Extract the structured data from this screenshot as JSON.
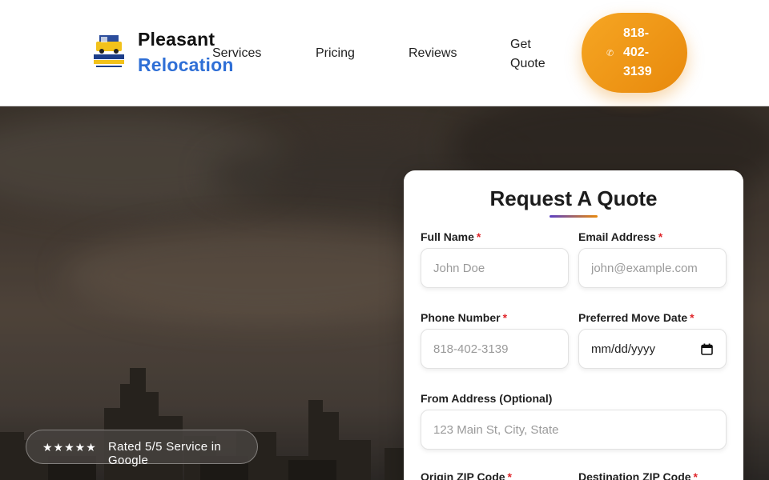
{
  "header": {
    "brand_line1": "Pleasant",
    "brand_line2": "Relocation",
    "logo_text": "PLEASANT RELOCATION",
    "nav": {
      "services": "Services",
      "pricing": "Pricing",
      "reviews": "Reviews",
      "get_quote": "Get Quote"
    },
    "phone": "818-402-3139",
    "phone_icon": "phone-icon",
    "accent_color": "#e8890c",
    "brand_color": "#2f6fd6"
  },
  "hero": {
    "rating_stars": "★★★★★",
    "rating_text": "Rated 5/5 Service in Google"
  },
  "quote_form": {
    "title": "Request A Quote",
    "required_mark": "*",
    "full_name": {
      "label": "Full Name",
      "placeholder": "John Doe"
    },
    "email": {
      "label": "Email Address",
      "placeholder": "john@example.com"
    },
    "phone": {
      "label": "Phone Number",
      "placeholder": "818-402-3139"
    },
    "move_date": {
      "label": "Preferred Move Date",
      "value": "mm/dd/yyyy"
    },
    "from_address": {
      "label": "From Address (Optional)",
      "placeholder": "123 Main St, City, State"
    },
    "origin_zip": {
      "label": "Origin ZIP Code"
    },
    "destination_zip": {
      "label": "Destination ZIP Code"
    }
  }
}
